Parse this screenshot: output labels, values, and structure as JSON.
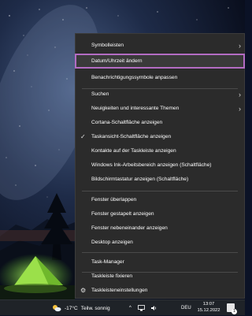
{
  "context_menu": {
    "items": [
      {
        "label": "Symbolleisten",
        "submenu": true
      },
      {
        "label": "Datum/Uhrzeit ändern",
        "highlighted": true
      },
      {
        "label": "Benachrichtigungssymbole anpassen"
      },
      {
        "label": "Suchen",
        "submenu": true
      },
      {
        "label": "Neuigkeiten und interessante Themen",
        "submenu": true
      },
      {
        "label": "Cortana-Schaltfläche anzeigen"
      },
      {
        "label": "Taskansicht-Schaltfläche anzeigen",
        "checked": true
      },
      {
        "label": "Kontakte auf der Taskleiste anzeigen"
      },
      {
        "label": "Windows Ink-Arbeitsbereich anzeigen (Schaltfläche)"
      },
      {
        "label": "Bildschirmtastatur anzeigen (Schaltfläche)"
      },
      {
        "label": "Fenster überlappen"
      },
      {
        "label": "Fenster gestapelt anzeigen"
      },
      {
        "label": "Fenster nebeneinander anzeigen"
      },
      {
        "label": "Desktop anzeigen"
      },
      {
        "label": "Task-Manager"
      },
      {
        "label": "Taskleiste fixieren"
      },
      {
        "label": "Taskleisteneinstellungen",
        "icon": "gear-icon"
      }
    ],
    "submenu_glyph": "›",
    "check_glyph": "✓",
    "gear_glyph": "⚙"
  },
  "taskbar": {
    "weather_temp": "-17°C",
    "weather_text": "Teilw. sonnig",
    "chevron": "^",
    "language": "DEU",
    "time": "13:07",
    "date": "15.12.2022",
    "notification_count": "1"
  },
  "colors": {
    "menu_bg": "#2b2b2b",
    "highlight_outline": "#b36cc3",
    "taskbar_bg": "#1f2328"
  }
}
